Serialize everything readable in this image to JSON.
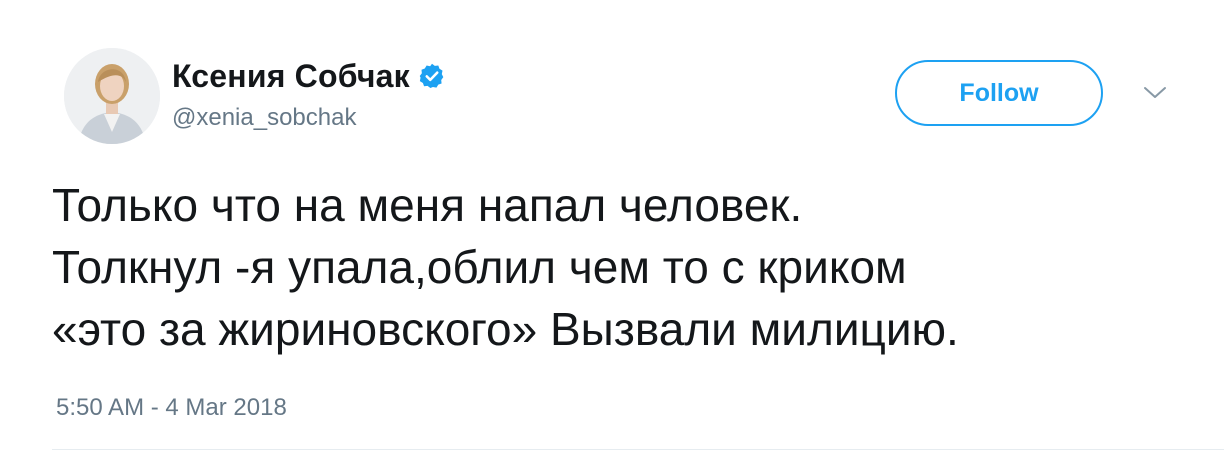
{
  "user": {
    "display_name": "Ксения Собчак",
    "handle": "@xenia_sobchak",
    "verified": true,
    "avatar_icon": "profile-photo"
  },
  "actions": {
    "follow_label": "Follow",
    "menu_icon": "chevron-down-icon"
  },
  "tweet": {
    "lines": [
      "Только что на меня напал человек.",
      "Толкнул -я упала,облил чем то с криком",
      "«это за жириновского» Вызвали милицию."
    ],
    "timestamp": "5:50 AM - 4 Mar 2018"
  },
  "colors": {
    "accent": "#1da1f2",
    "text": "#14171a",
    "secondary_text": "#657786",
    "divider": "#e6ecf0"
  }
}
